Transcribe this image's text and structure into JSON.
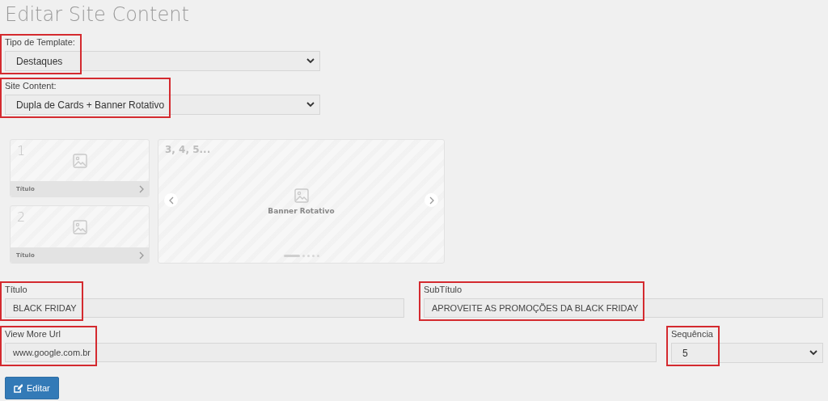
{
  "page_title": "Editar Site Content",
  "selects": [
    {
      "label": "Tipo de Template:",
      "value": "Destaques",
      "highlighted": true
    },
    {
      "label": "Site Content:",
      "value": "Dupla de Cards + Banner Rotativo",
      "highlighted": true
    }
  ],
  "preview": {
    "cards": [
      {
        "number": "1",
        "caption": "Título"
      },
      {
        "number": "2",
        "caption": "Título"
      }
    ],
    "banner": {
      "number": "3, 4, 5...",
      "label": "Banner Rotativo",
      "dots": [
        {
          "selected": true
        },
        {
          "selected": false
        },
        {
          "selected": false
        },
        {
          "selected": false
        },
        {
          "selected": false
        }
      ]
    }
  },
  "field_rows": [
    [
      {
        "kind": "input",
        "label": "Título",
        "value": "BLACK FRIDAY",
        "highlighted": true
      },
      {
        "kind": "input",
        "label": "SubTítulo",
        "value": "APROVEITE AS PROMOÇÕES DA BLACK FRIDAY",
        "highlighted": true
      }
    ],
    [
      {
        "kind": "input",
        "label": "View More Url",
        "value": "www.google.com.br",
        "highlighted": true
      },
      {
        "kind": "select",
        "label": "Sequência",
        "value": "5",
        "highlighted": true
      }
    ]
  ],
  "submit_button": "Editar"
}
